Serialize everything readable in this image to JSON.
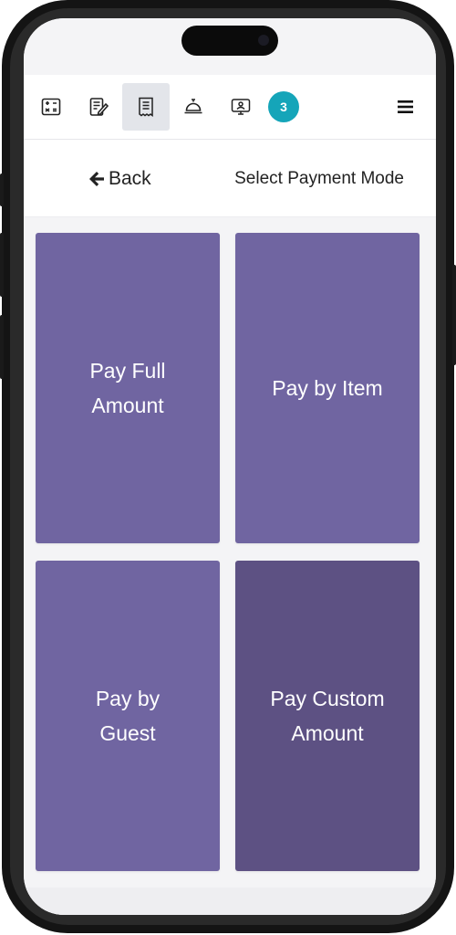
{
  "toolbar": {
    "icons": [
      "dashboard-icon",
      "order-edit-icon",
      "receipt-icon",
      "service-bell-icon",
      "kiosk-display-icon"
    ],
    "active_index": 2,
    "badge_count": "3",
    "menu_icon": "hamburger-menu-icon"
  },
  "header": {
    "back_label": "Back",
    "title": "Select Payment Mode"
  },
  "payment_options": [
    {
      "label": "Pay Full Amount"
    },
    {
      "label": "Pay by Item"
    },
    {
      "label": "Pay by Guest"
    },
    {
      "label": "Pay Custom Amount"
    }
  ],
  "colors": {
    "tile": "#7065a1",
    "tile_selected": "#5d5183",
    "badge": "#15a5b9"
  }
}
